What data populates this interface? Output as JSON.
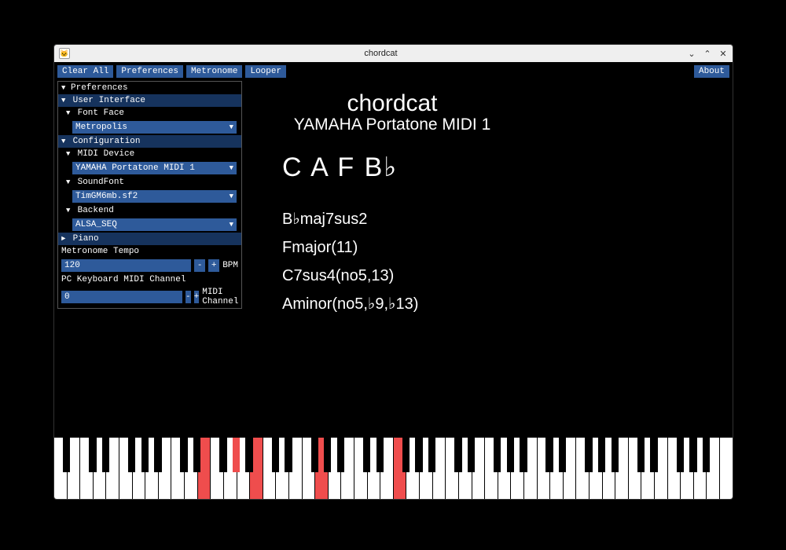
{
  "window": {
    "title": "chordcat"
  },
  "toolbar": {
    "clear_all": "Clear All",
    "preferences": "Preferences",
    "metronome": "Metronome",
    "looper": "Looper",
    "about": "About"
  },
  "prefs": {
    "title": "Preferences",
    "ui_section": "User Interface",
    "font_face_label": "Font Face",
    "font_face_value": "Metropolis",
    "config_section": "Configuration",
    "midi_device_label": "MIDI Device",
    "midi_device_value": "YAMAHA Portatone MIDI 1",
    "soundfont_label": "SoundFont",
    "soundfont_value": "TimGM6mb.sf2",
    "backend_label": "Backend",
    "backend_value": "ALSA_SEQ",
    "piano_section": "Piano",
    "tempo_label": "Metronome Tempo",
    "tempo_value": "120",
    "tempo_unit": "BPM",
    "channel_label": "PC Keyboard MIDI Channel",
    "channel_value": "0",
    "channel_unit": "MIDI Channel"
  },
  "display": {
    "appname": "chordcat",
    "device": "YAMAHA Portatone MIDI 1",
    "notes": "C A F B♭",
    "chords": [
      "B♭maj7sus2",
      "Fmajor(11)",
      "C7sus4(no5,13)",
      "Aminor(no5,♭9,♭13)"
    ]
  },
  "piano": {
    "white_count": 52,
    "active_white": [
      11,
      15,
      20,
      26
    ],
    "active_black": [
      13
    ]
  },
  "icons": {
    "minimize": "⌄",
    "maximize": "⌃",
    "close": "✕",
    "tri_down": "▼",
    "tri_right": "►",
    "minus": "-",
    "plus": "+"
  }
}
